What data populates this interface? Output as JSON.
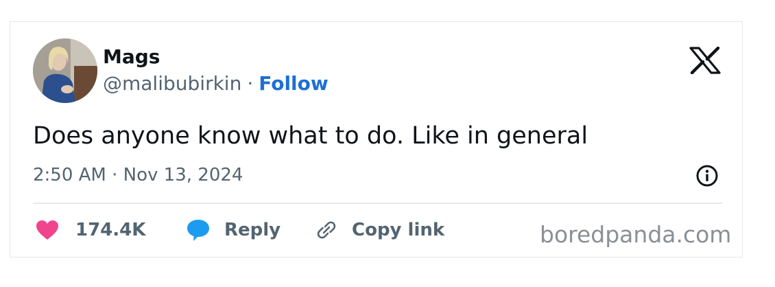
{
  "tweet": {
    "author_name": "Mags",
    "handle": "@malibubirkin",
    "separator": "·",
    "follow_label": "Follow",
    "text": "Does anyone know what to do. Like in general",
    "timestamp": "2:50 AM · Nov 13, 2024"
  },
  "actions": {
    "likes_count": "174.4K",
    "reply_label": "Reply",
    "copy_link_label": "Copy link"
  },
  "icons": {
    "logo": "x-logo-icon",
    "info": "info-icon",
    "like": "heart-icon",
    "reply": "speech-bubble-icon",
    "copy": "link-icon"
  },
  "colors": {
    "follow": "#1d6fd3",
    "heart": "#f0458c",
    "reply_bubble": "#1d9bf0",
    "muted": "#536471",
    "text": "#0f1419"
  },
  "watermark": "boredpanda.com"
}
